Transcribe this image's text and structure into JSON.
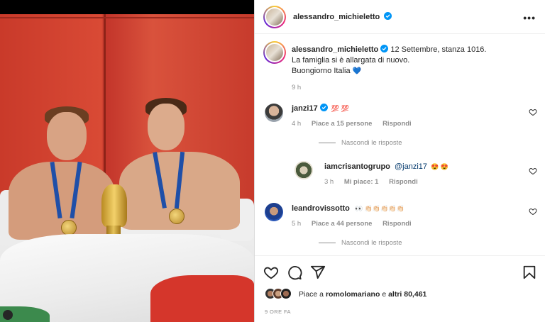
{
  "post": {
    "author": "alessandro_michieletto",
    "caption_line1": "12 Settembre, stanza 1016.",
    "caption_line2": "La famiglia si è allargata di nuovo.",
    "caption_line3": "Buongiorno Italia",
    "caption_emoji": "💙",
    "caption_time": "9 h"
  },
  "comments": [
    {
      "user": "janzi17",
      "text": "💯 💯",
      "time": "4 h",
      "likes": "Piace a 15 persone",
      "reply": "Rispondi"
    },
    {
      "user": "iamcrisantogrupo",
      "mention": "@janzi17",
      "text": "😍 😍",
      "time": "3 h",
      "likes": "Mi piace: 1",
      "reply": "Rispondi"
    },
    {
      "user": "leandrovissotto",
      "text": "👀 👏🏻👏🏻👏🏻👏🏻👏🏻",
      "time": "5 h",
      "likes": "Piace a 44 persone",
      "reply": "Rispondi"
    }
  ],
  "hide_replies_1": "Nascondi le risposte",
  "hide_replies_2": "Nascondi le risposte",
  "likes": {
    "prefix": "Piace a",
    "user": "romolomariano",
    "joiner": "e",
    "others": "altri 80,461"
  },
  "time_ago": "9 ORE FA",
  "colors": {
    "verified": "#0095f6",
    "muted": "#8e8e8e",
    "text": "#262626"
  }
}
